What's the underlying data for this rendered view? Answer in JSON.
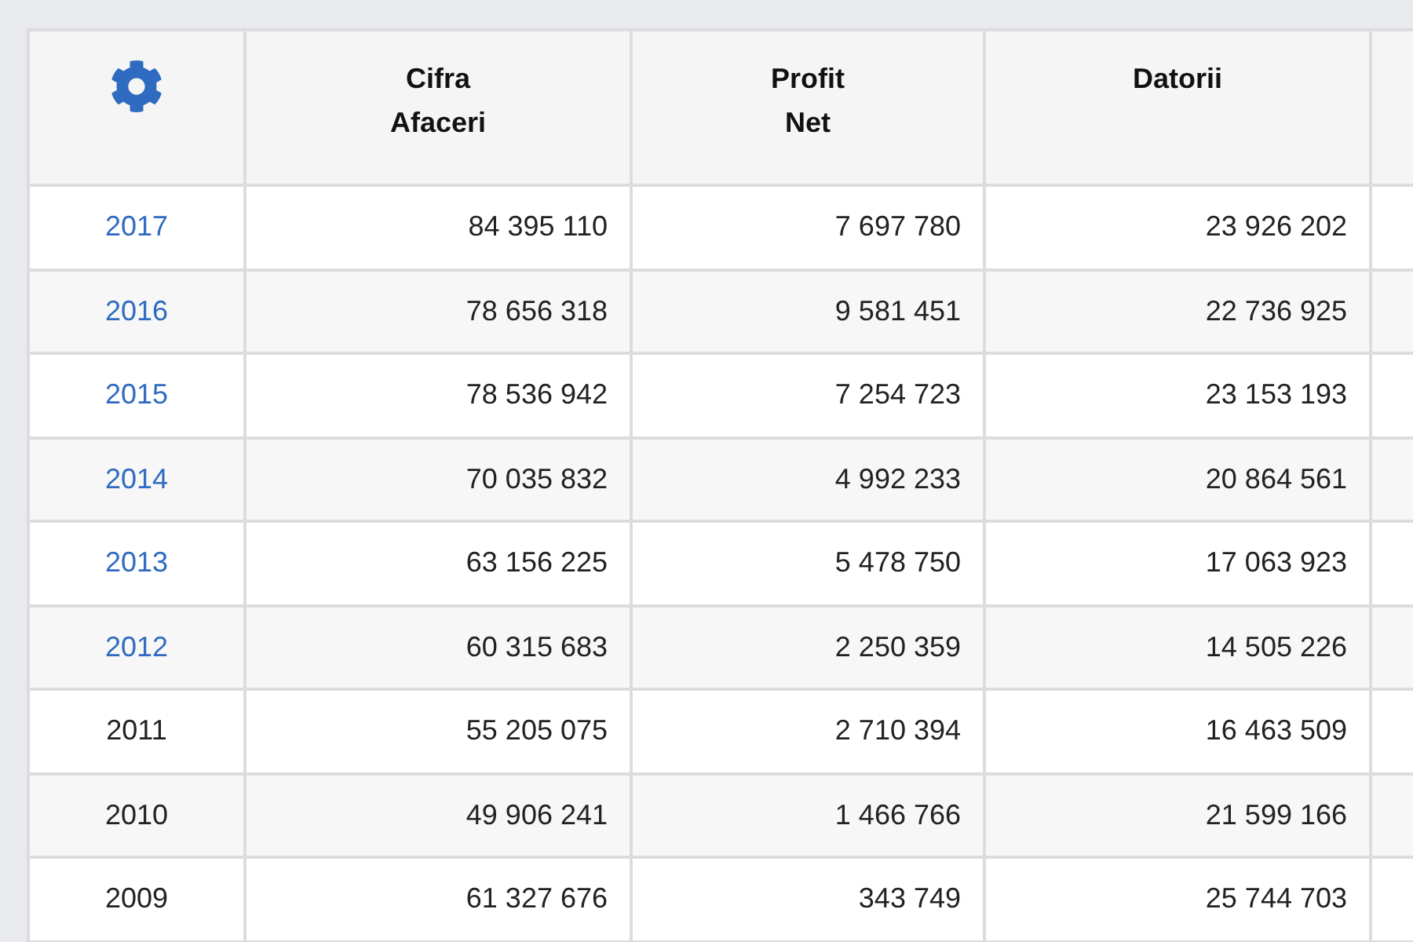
{
  "table": {
    "columns": [
      {
        "kind": "settings"
      },
      {
        "kind": "text",
        "lines": [
          "Cifra",
          "Afaceri"
        ]
      },
      {
        "kind": "text",
        "lines": [
          "Profit",
          "Net"
        ]
      },
      {
        "kind": "text",
        "lines": [
          "Datorii"
        ]
      },
      {
        "kind": "blank"
      }
    ],
    "rows": [
      {
        "year": "2017",
        "linked": true,
        "values": [
          "84 395 110",
          "7 697 780",
          "23 926 202"
        ]
      },
      {
        "year": "2016",
        "linked": true,
        "values": [
          "78 656 318",
          "9 581 451",
          "22 736 925"
        ]
      },
      {
        "year": "2015",
        "linked": true,
        "values": [
          "78 536 942",
          "7 254 723",
          "23 153 193"
        ]
      },
      {
        "year": "2014",
        "linked": true,
        "values": [
          "70 035 832",
          "4 992 233",
          "20 864 561"
        ]
      },
      {
        "year": "2013",
        "linked": true,
        "values": [
          "63 156 225",
          "5 478 750",
          "17 063 923"
        ]
      },
      {
        "year": "2012",
        "linked": true,
        "values": [
          "60 315 683",
          "2 250 359",
          "14 505 226"
        ]
      },
      {
        "year": "2011",
        "linked": false,
        "values": [
          "55 205 075",
          "2 710 394",
          "16 463 509"
        ]
      },
      {
        "year": "2010",
        "linked": false,
        "values": [
          "49 906 241",
          "1 466 766",
          "21 599 166"
        ]
      },
      {
        "year": "2009",
        "linked": false,
        "values": [
          "61 327 676",
          "343 749",
          "25 744 703"
        ]
      }
    ]
  }
}
